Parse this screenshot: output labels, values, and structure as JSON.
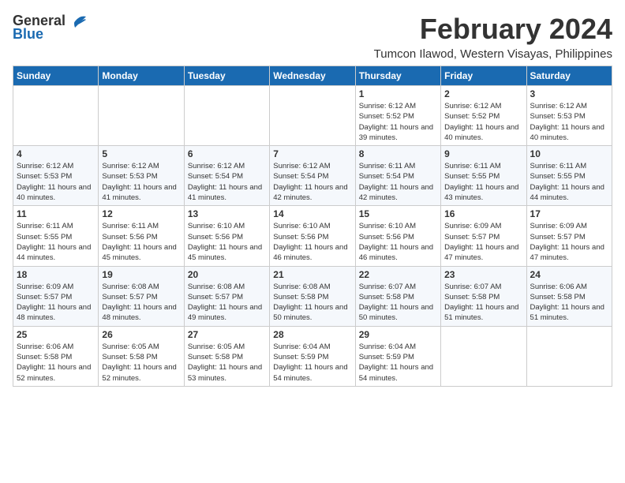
{
  "header": {
    "logo_general": "General",
    "logo_blue": "Blue",
    "month_title": "February 2024",
    "location": "Tumcon Ilawod, Western Visayas, Philippines"
  },
  "calendar": {
    "days_of_week": [
      "Sunday",
      "Monday",
      "Tuesday",
      "Wednesday",
      "Thursday",
      "Friday",
      "Saturday"
    ],
    "weeks": [
      [
        {
          "day": "",
          "info": ""
        },
        {
          "day": "",
          "info": ""
        },
        {
          "day": "",
          "info": ""
        },
        {
          "day": "",
          "info": ""
        },
        {
          "day": "1",
          "info": "Sunrise: 6:12 AM\nSunset: 5:52 PM\nDaylight: 11 hours and 39 minutes."
        },
        {
          "day": "2",
          "info": "Sunrise: 6:12 AM\nSunset: 5:52 PM\nDaylight: 11 hours and 40 minutes."
        },
        {
          "day": "3",
          "info": "Sunrise: 6:12 AM\nSunset: 5:53 PM\nDaylight: 11 hours and 40 minutes."
        }
      ],
      [
        {
          "day": "4",
          "info": "Sunrise: 6:12 AM\nSunset: 5:53 PM\nDaylight: 11 hours and 40 minutes."
        },
        {
          "day": "5",
          "info": "Sunrise: 6:12 AM\nSunset: 5:53 PM\nDaylight: 11 hours and 41 minutes."
        },
        {
          "day": "6",
          "info": "Sunrise: 6:12 AM\nSunset: 5:54 PM\nDaylight: 11 hours and 41 minutes."
        },
        {
          "day": "7",
          "info": "Sunrise: 6:12 AM\nSunset: 5:54 PM\nDaylight: 11 hours and 42 minutes."
        },
        {
          "day": "8",
          "info": "Sunrise: 6:11 AM\nSunset: 5:54 PM\nDaylight: 11 hours and 42 minutes."
        },
        {
          "day": "9",
          "info": "Sunrise: 6:11 AM\nSunset: 5:55 PM\nDaylight: 11 hours and 43 minutes."
        },
        {
          "day": "10",
          "info": "Sunrise: 6:11 AM\nSunset: 5:55 PM\nDaylight: 11 hours and 44 minutes."
        }
      ],
      [
        {
          "day": "11",
          "info": "Sunrise: 6:11 AM\nSunset: 5:55 PM\nDaylight: 11 hours and 44 minutes."
        },
        {
          "day": "12",
          "info": "Sunrise: 6:11 AM\nSunset: 5:56 PM\nDaylight: 11 hours and 45 minutes."
        },
        {
          "day": "13",
          "info": "Sunrise: 6:10 AM\nSunset: 5:56 PM\nDaylight: 11 hours and 45 minutes."
        },
        {
          "day": "14",
          "info": "Sunrise: 6:10 AM\nSunset: 5:56 PM\nDaylight: 11 hours and 46 minutes."
        },
        {
          "day": "15",
          "info": "Sunrise: 6:10 AM\nSunset: 5:56 PM\nDaylight: 11 hours and 46 minutes."
        },
        {
          "day": "16",
          "info": "Sunrise: 6:09 AM\nSunset: 5:57 PM\nDaylight: 11 hours and 47 minutes."
        },
        {
          "day": "17",
          "info": "Sunrise: 6:09 AM\nSunset: 5:57 PM\nDaylight: 11 hours and 47 minutes."
        }
      ],
      [
        {
          "day": "18",
          "info": "Sunrise: 6:09 AM\nSunset: 5:57 PM\nDaylight: 11 hours and 48 minutes."
        },
        {
          "day": "19",
          "info": "Sunrise: 6:08 AM\nSunset: 5:57 PM\nDaylight: 11 hours and 48 minutes."
        },
        {
          "day": "20",
          "info": "Sunrise: 6:08 AM\nSunset: 5:57 PM\nDaylight: 11 hours and 49 minutes."
        },
        {
          "day": "21",
          "info": "Sunrise: 6:08 AM\nSunset: 5:58 PM\nDaylight: 11 hours and 50 minutes."
        },
        {
          "day": "22",
          "info": "Sunrise: 6:07 AM\nSunset: 5:58 PM\nDaylight: 11 hours and 50 minutes."
        },
        {
          "day": "23",
          "info": "Sunrise: 6:07 AM\nSunset: 5:58 PM\nDaylight: 11 hours and 51 minutes."
        },
        {
          "day": "24",
          "info": "Sunrise: 6:06 AM\nSunset: 5:58 PM\nDaylight: 11 hours and 51 minutes."
        }
      ],
      [
        {
          "day": "25",
          "info": "Sunrise: 6:06 AM\nSunset: 5:58 PM\nDaylight: 11 hours and 52 minutes."
        },
        {
          "day": "26",
          "info": "Sunrise: 6:05 AM\nSunset: 5:58 PM\nDaylight: 11 hours and 52 minutes."
        },
        {
          "day": "27",
          "info": "Sunrise: 6:05 AM\nSunset: 5:58 PM\nDaylight: 11 hours and 53 minutes."
        },
        {
          "day": "28",
          "info": "Sunrise: 6:04 AM\nSunset: 5:59 PM\nDaylight: 11 hours and 54 minutes."
        },
        {
          "day": "29",
          "info": "Sunrise: 6:04 AM\nSunset: 5:59 PM\nDaylight: 11 hours and 54 minutes."
        },
        {
          "day": "",
          "info": ""
        },
        {
          "day": "",
          "info": ""
        }
      ]
    ]
  }
}
